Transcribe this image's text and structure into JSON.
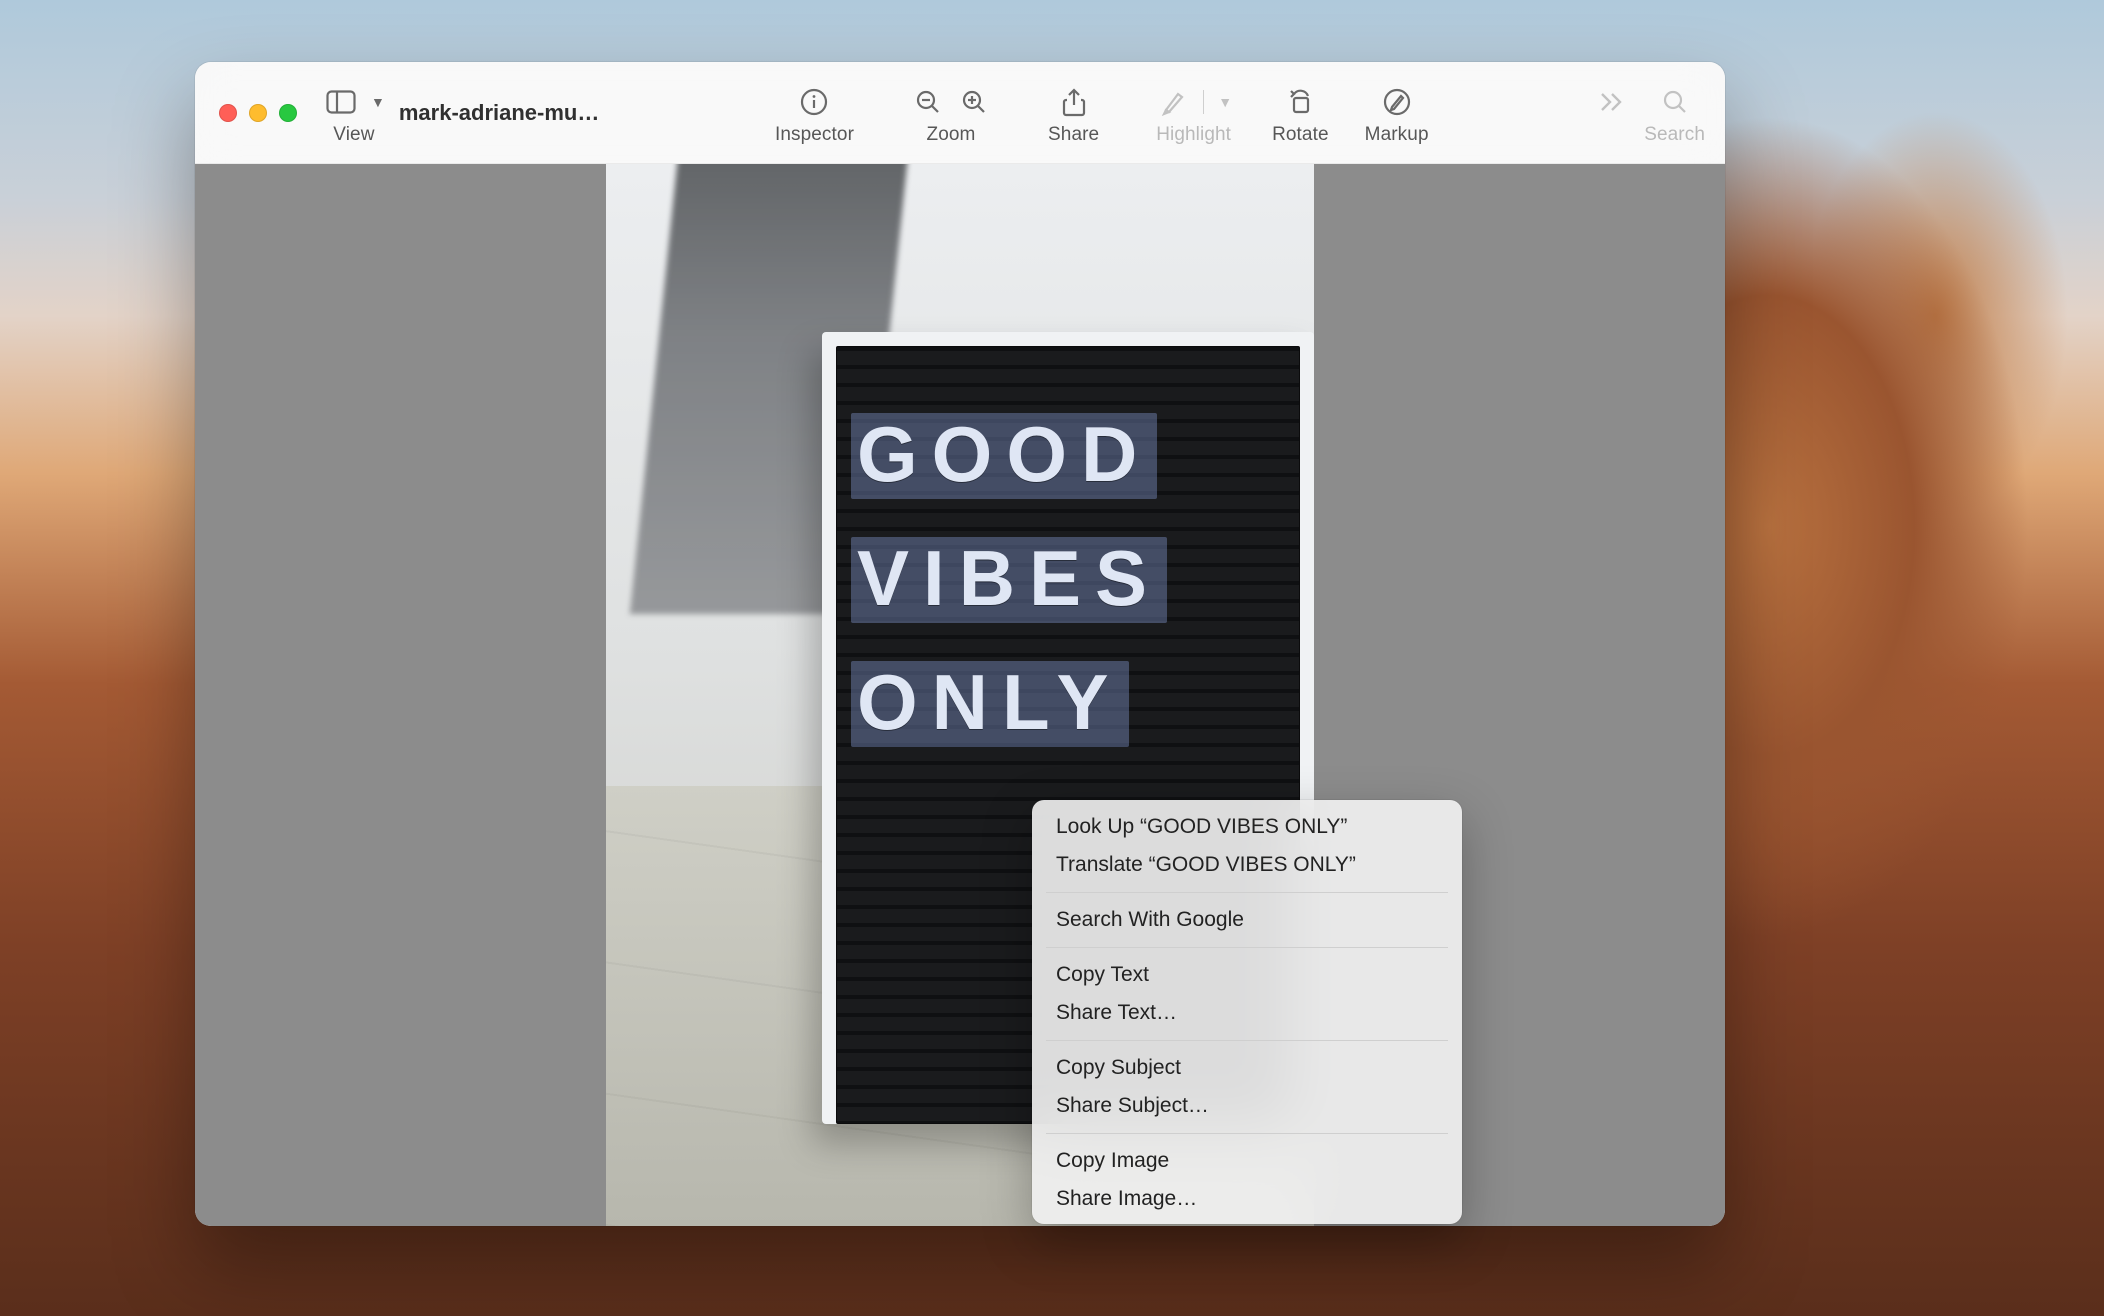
{
  "window": {
    "title": "mark-adriane-mu…"
  },
  "toolbar": {
    "view_label": "View",
    "inspector_label": "Inspector",
    "zoom_label": "Zoom",
    "share_label": "Share",
    "highlight_label": "Highlight",
    "rotate_label": "Rotate",
    "markup_label": "Markup",
    "search_label": "Search"
  },
  "image_text": {
    "line1": "GOOD",
    "line2": "VIBES",
    "line3": "ONLY"
  },
  "selection_text": "GOOD VIBES ONLY",
  "context_menu": {
    "lookup": "Look Up “GOOD VIBES ONLY”",
    "translate": "Translate “GOOD VIBES ONLY”",
    "search_google": "Search With Google",
    "copy_text": "Copy Text",
    "share_text": "Share Text…",
    "copy_subject": "Copy Subject",
    "share_subject": "Share Subject…",
    "copy_image": "Copy Image",
    "share_image": "Share Image…"
  }
}
